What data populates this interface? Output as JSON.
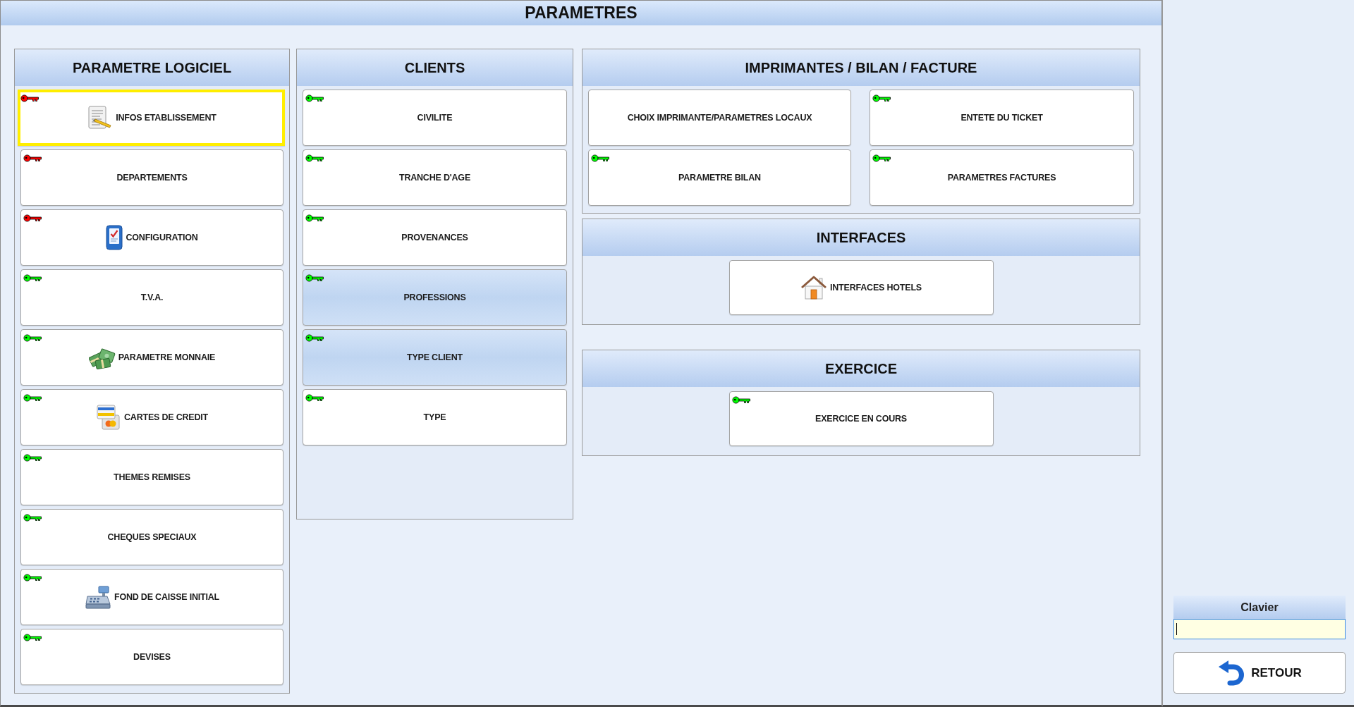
{
  "title": "PARAMETRES",
  "columns": [
    {
      "sections": [
        {
          "title": "PARAMETRE LOGICIEL",
          "kind": "list",
          "buttons": [
            {
              "label": "INFOS ETABLISSEMENT",
              "key": {
                "color": "#ff0000"
              },
              "selected": true,
              "highlighted": false
            },
            {
              "label": "DEPARTEMENTS",
              "key": {
                "color": "#ff0000"
              },
              "selected": false,
              "highlighted": false
            },
            {
              "label": "CONFIGURATION",
              "key": {
                "color": "#ff0000"
              },
              "selected": false,
              "highlighted": false
            },
            {
              "label": "T.V.A.",
              "key": {
                "color": "#00ff00"
              },
              "selected": false,
              "highlighted": false
            },
            {
              "label": "PARAMETRE MONNAIE",
              "key": {
                "color": "#00ff00"
              },
              "selected": false,
              "highlighted": false
            },
            {
              "label": "CARTES DE CREDIT",
              "key": {
                "color": "#00ff00"
              },
              "selected": false,
              "highlighted": false
            },
            {
              "label": "THEMES REMISES",
              "key": {
                "color": "#00ff00"
              },
              "selected": false,
              "highlighted": false
            },
            {
              "label": "CHEQUES SPECIAUX",
              "key": {
                "color": "#00ff00"
              },
              "selected": false,
              "highlighted": false
            },
            {
              "label": "FOND DE CAISSE INITIAL",
              "key": {
                "color": "#00ff00"
              },
              "selected": false,
              "highlighted": false
            },
            {
              "label": "DEVISES",
              "key": {
                "color": "#00ff00"
              },
              "selected": false,
              "highlighted": false
            }
          ]
        }
      ]
    },
    {
      "sections": [
        {
          "title": "CLIENTS",
          "kind": "list",
          "buttons": [
            {
              "label": "CIVILITE",
              "key": {
                "color": "#00ff00"
              },
              "selected": false,
              "highlighted": false
            },
            {
              "label": "TRANCHE D'AGE",
              "key": {
                "color": "#00ff00"
              },
              "selected": false,
              "highlighted": false
            },
            {
              "label": "PROVENANCES",
              "key": {
                "color": "#00ff00"
              },
              "selected": false,
              "highlighted": false
            },
            {
              "label": "PROFESSIONS",
              "key": {
                "color": "#00ff00"
              },
              "selected": false,
              "highlighted": true
            },
            {
              "label": "TYPE CLIENT",
              "key": {
                "color": "#00ff00"
              },
              "selected": false,
              "highlighted": true
            },
            {
              "label": "TYPE",
              "key": {
                "color": "#00ff00"
              },
              "selected": false,
              "highlighted": false
            }
          ]
        }
      ]
    },
    {
      "sections": [
        {
          "title": "IMPRIMANTES / BILAN / FACTURE",
          "kind": "grid",
          "buttons": [
            {
              "label": "CHOIX IMPRIMANTE/PARAMETRES LOCAUX",
              "selected": false,
              "highlighted": false
            },
            {
              "label": "ENTETE DU TICKET",
              "key": {
                "color": "#00ff00"
              },
              "selected": false,
              "highlighted": false
            },
            {
              "label": "PARAMETRE BILAN",
              "key": {
                "color": "#00ff00"
              },
              "selected": false,
              "highlighted": false
            },
            {
              "label": "PARAMETRES FACTURES",
              "key": {
                "color": "#00ff00"
              },
              "selected": false,
              "highlighted": false
            }
          ]
        },
        {
          "title": "INTERFACES",
          "kind": "single",
          "buttons": [
            {
              "label": "INTERFACES HOTELS",
              "selected": false,
              "highlighted": false
            }
          ]
        },
        {
          "title": "EXERCICE",
          "kind": "single",
          "buttons": [
            {
              "label": "EXERCICE EN COURS",
              "key": {
                "color": "#00ff00"
              },
              "selected": false,
              "highlighted": false
            }
          ]
        }
      ]
    }
  ],
  "keyboard": {
    "label": "Clavier"
  },
  "back_button": {
    "label": "RETOUR"
  }
}
